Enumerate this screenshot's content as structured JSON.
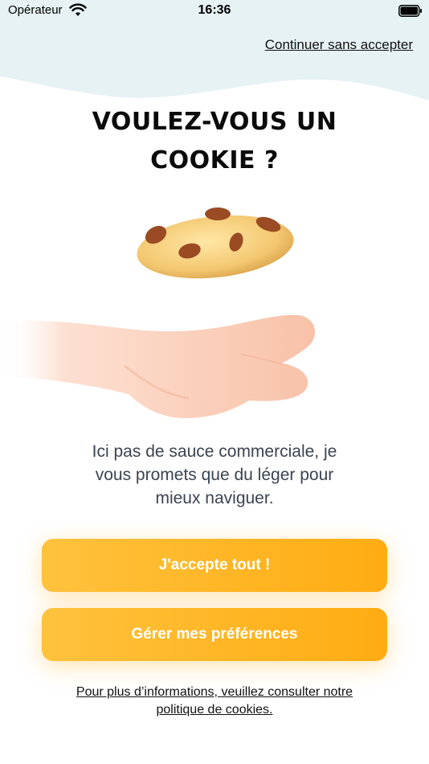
{
  "status_bar": {
    "carrier": "Opérateur",
    "time": "16:36",
    "icons": [
      "wifi-icon",
      "battery-icon"
    ]
  },
  "header": {
    "skip_label": "Continuer sans accepter"
  },
  "main": {
    "title_line1": "VOULEZ-VOUS UN",
    "title_line2": "COOKIE ?",
    "illustration": "cookie-hand-illustration",
    "description_line1": "Ici pas de sauce commerciale, je",
    "description_line2": "vous promets que du léger pour",
    "description_line3": "mieux naviguer."
  },
  "actions": {
    "accept_all_label": "J'accepte tout !",
    "manage_prefs_label": "Gérer mes préférences"
  },
  "footer": {
    "policy_line1": "Pour plus d’informations, veuillez consulter notre",
    "policy_line2": "politique de cookies."
  },
  "colors": {
    "wave": "#e6f2f3",
    "button_start": "#ffc23d",
    "button_end": "#ffac12",
    "text": "#3b4450"
  }
}
